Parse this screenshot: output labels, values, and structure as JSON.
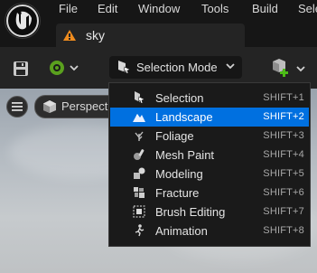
{
  "menu": {
    "items": [
      "File",
      "Edit",
      "Window",
      "Tools",
      "Build",
      "Sele"
    ]
  },
  "tab": {
    "label": "sky"
  },
  "toolbar": {
    "mode_label": "Selection Mode",
    "icons": [
      "save-icon",
      "source-control-icon",
      "chevron-down-icon",
      "add-content-icon"
    ]
  },
  "viewport": {
    "view_label": "Perspective"
  },
  "modes": {
    "items": [
      {
        "label": "Selection",
        "shortcut": "SHIFT+1",
        "icon": "selection-icon",
        "selected": false
      },
      {
        "label": "Landscape",
        "shortcut": "SHIFT+2",
        "icon": "landscape-icon",
        "selected": true
      },
      {
        "label": "Foliage",
        "shortcut": "SHIFT+3",
        "icon": "foliage-icon",
        "selected": false
      },
      {
        "label": "Mesh Paint",
        "shortcut": "SHIFT+4",
        "icon": "mesh-paint-icon",
        "selected": false
      },
      {
        "label": "Modeling",
        "shortcut": "SHIFT+5",
        "icon": "modeling-icon",
        "selected": false
      },
      {
        "label": "Fracture",
        "shortcut": "SHIFT+6",
        "icon": "fracture-icon",
        "selected": false
      },
      {
        "label": "Brush Editing",
        "shortcut": "SHIFT+7",
        "icon": "brush-editing-icon",
        "selected": false
      },
      {
        "label": "Animation",
        "shortcut": "SHIFT+8",
        "icon": "animation-icon",
        "selected": false
      }
    ]
  },
  "colors": {
    "highlight": "#0070e0",
    "tab_icon": "#f08c1e",
    "source_control": "#5aa01e",
    "add_plus": "#4cbb17"
  }
}
